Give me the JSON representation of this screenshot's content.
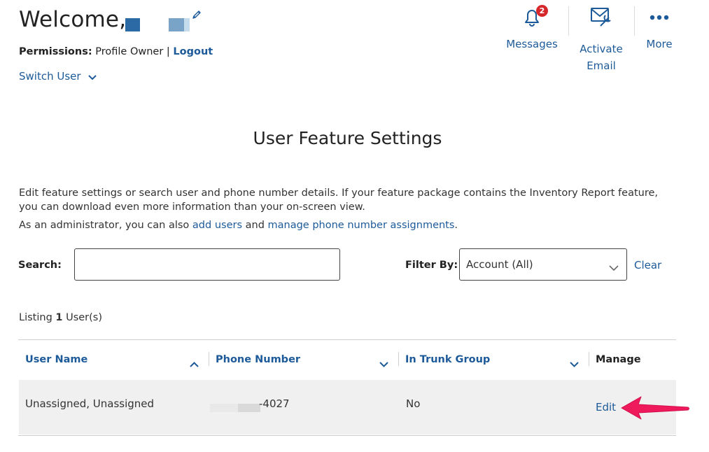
{
  "header": {
    "welcome": "Welcome,",
    "permissions_label": "Permissions:",
    "permissions_value": "Profile Owner",
    "separator": "|",
    "logout": "Logout",
    "switch_user": "Switch User"
  },
  "topnav": {
    "messages_label": "Messages",
    "messages_badge": "2",
    "activate_email_line1": "Activate",
    "activate_email_line2": "Email",
    "more_label": "More"
  },
  "page": {
    "title": "User Feature Settings",
    "description": "Edit feature settings or search user and phone number details. If your feature package contains the Inventory Report feature, you can download even more information than your on-screen view.",
    "admin_prefix": "As an administrator, you can also ",
    "add_users_link": "add users",
    "admin_middle": " and ",
    "manage_phone_link": "manage phone number assignments",
    "admin_suffix": "."
  },
  "search": {
    "label": "Search:",
    "value": "",
    "placeholder": ""
  },
  "filter": {
    "label": "Filter By:",
    "selected": "Account (All)",
    "clear": "Clear"
  },
  "listing": {
    "prefix": "Listing ",
    "count": "1",
    "suffix": " User(s)"
  },
  "table": {
    "headers": {
      "user_name": "User Name",
      "phone_number": "Phone Number",
      "in_trunk_group": "In Trunk Group",
      "manage": "Manage"
    },
    "rows": [
      {
        "user_name": "Unassigned, Unassigned",
        "phone_number": "-4027",
        "in_trunk_group": "No",
        "manage": "Edit"
      }
    ]
  },
  "colors": {
    "link": "#1d5a99",
    "badge": "#d6282b",
    "annotation_arrow": "#ef1a5c",
    "row_background": "#f0f0f0"
  },
  "icons": [
    "pencil-icon",
    "chevron-down-icon",
    "bell-icon",
    "envelope-gear-icon",
    "more-dots-icon",
    "sort-asc-icon",
    "sort-desc-icon",
    "annotation-arrow-icon"
  ]
}
